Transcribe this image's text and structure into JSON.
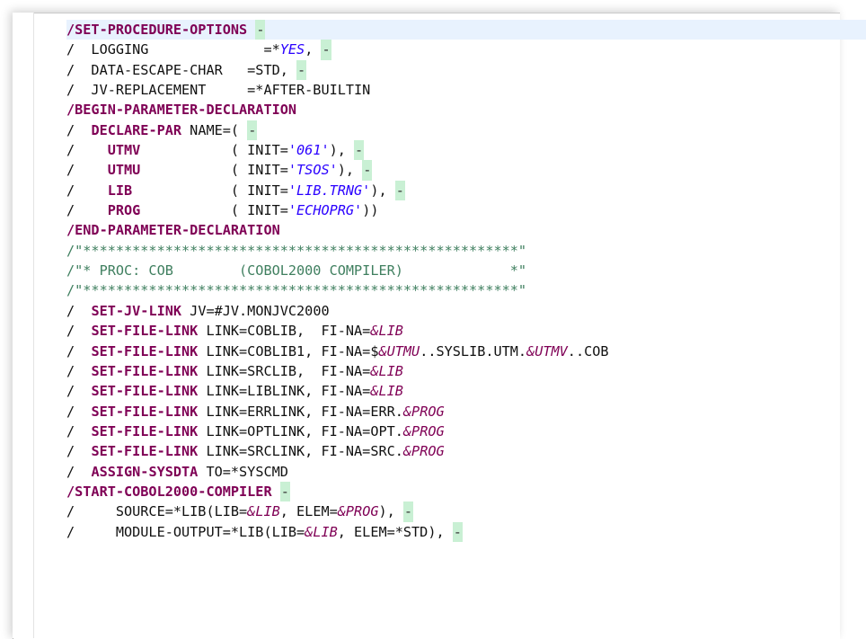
{
  "lines": [
    {
      "current": true,
      "segs": [
        [
          "kw",
          "/SET-PROCEDURE-OPTIONS"
        ],
        [
          "plain",
          " "
        ],
        [
          "cont",
          "-"
        ]
      ]
    },
    {
      "segs": [
        [
          "plain",
          "/  LOGGING              =*"
        ],
        [
          "str-up",
          "YES"
        ],
        [
          "plain",
          ", "
        ],
        [
          "cont",
          "-"
        ]
      ]
    },
    {
      "segs": [
        [
          "plain",
          "/  DATA-ESCAPE-CHAR   =STD, "
        ],
        [
          "cont",
          "-"
        ]
      ]
    },
    {
      "segs": [
        [
          "plain",
          "/  JV-REPLACEMENT     =*AFTER-BUILTIN"
        ]
      ]
    },
    {
      "segs": [
        [
          "kw",
          "/BEGIN-PARAMETER-DECLARATION"
        ]
      ]
    },
    {
      "segs": [
        [
          "plain",
          "/  "
        ],
        [
          "kw",
          "DECLARE-PAR"
        ],
        [
          "plain",
          " NAME=( "
        ],
        [
          "cont",
          "-"
        ]
      ]
    },
    {
      "segs": [
        [
          "plain",
          "/    "
        ],
        [
          "kw",
          "UTMV"
        ],
        [
          "plain",
          "           ( INIT="
        ],
        [
          "str",
          "'061'"
        ],
        [
          "plain",
          "), "
        ],
        [
          "cont",
          "-"
        ]
      ]
    },
    {
      "segs": [
        [
          "plain",
          "/    "
        ],
        [
          "kw",
          "UTMU"
        ],
        [
          "plain",
          "           ( INIT="
        ],
        [
          "str",
          "'TSOS'"
        ],
        [
          "plain",
          "), "
        ],
        [
          "cont",
          "-"
        ]
      ]
    },
    {
      "segs": [
        [
          "plain",
          "/    "
        ],
        [
          "kw",
          "LIB"
        ],
        [
          "plain",
          "            ( INIT="
        ],
        [
          "str",
          "'LIB.TRNG'"
        ],
        [
          "plain",
          "), "
        ],
        [
          "cont",
          "-"
        ]
      ]
    },
    {
      "segs": [
        [
          "plain",
          "/    "
        ],
        [
          "kw",
          "PROG"
        ],
        [
          "plain",
          "           ( INIT="
        ],
        [
          "str",
          "'ECHOPRG'"
        ],
        [
          "plain",
          "))"
        ]
      ]
    },
    {
      "segs": [
        [
          "kw",
          "/END-PARAMETER-DECLARATION"
        ]
      ]
    },
    {
      "segs": [
        [
          "cmt",
          "/\"*****************************************************\""
        ]
      ]
    },
    {
      "segs": [
        [
          "cmt",
          "/\"* PROC: COB        (COBOL2000 COMPILER)             *\""
        ]
      ]
    },
    {
      "segs": [
        [
          "cmt",
          "/\"*****************************************************\""
        ]
      ]
    },
    {
      "segs": [
        [
          "plain",
          "/  "
        ],
        [
          "kw",
          "SET-JV-LINK"
        ],
        [
          "plain",
          " JV=#JV.MONJVC2000"
        ]
      ]
    },
    {
      "segs": [
        [
          "plain",
          "/  "
        ],
        [
          "kw",
          "SET-FILE-LINK"
        ],
        [
          "plain",
          " LINK=COBLIB,  FI-NA="
        ],
        [
          "var",
          "&LIB"
        ]
      ]
    },
    {
      "segs": [
        [
          "plain",
          "/  "
        ],
        [
          "kw",
          "SET-FILE-LINK"
        ],
        [
          "plain",
          " LINK=COBLIB1, FI-NA=$"
        ],
        [
          "var",
          "&UTMU"
        ],
        [
          "plain",
          "..SYSLIB.UTM."
        ],
        [
          "var",
          "&UTMV"
        ],
        [
          "plain",
          "..COB"
        ]
      ]
    },
    {
      "segs": [
        [
          "plain",
          "/  "
        ],
        [
          "kw",
          "SET-FILE-LINK"
        ],
        [
          "plain",
          " LINK=SRCLIB,  FI-NA="
        ],
        [
          "var",
          "&LIB"
        ]
      ]
    },
    {
      "segs": [
        [
          "plain",
          "/  "
        ],
        [
          "kw",
          "SET-FILE-LINK"
        ],
        [
          "plain",
          " LINK=LIBLINK, FI-NA="
        ],
        [
          "var",
          "&LIB"
        ]
      ]
    },
    {
      "segs": [
        [
          "plain",
          "/  "
        ],
        [
          "kw",
          "SET-FILE-LINK"
        ],
        [
          "plain",
          " LINK=ERRLINK, FI-NA=ERR."
        ],
        [
          "var",
          "&PROG"
        ]
      ]
    },
    {
      "segs": [
        [
          "plain",
          "/  "
        ],
        [
          "kw",
          "SET-FILE-LINK"
        ],
        [
          "plain",
          " LINK=OPTLINK, FI-NA=OPT."
        ],
        [
          "var",
          "&PROG"
        ]
      ]
    },
    {
      "segs": [
        [
          "plain",
          "/  "
        ],
        [
          "kw",
          "SET-FILE-LINK"
        ],
        [
          "plain",
          " LINK=SRCLINK, FI-NA=SRC."
        ],
        [
          "var",
          "&PROG"
        ]
      ]
    },
    {
      "segs": [
        [
          "plain",
          "/  "
        ],
        [
          "kw",
          "ASSIGN-SYSDTA"
        ],
        [
          "plain",
          " TO=*SYSCMD"
        ]
      ]
    },
    {
      "segs": [
        [
          "kw",
          "/START-COBOL2000-COMPILER"
        ],
        [
          "plain",
          " "
        ],
        [
          "cont",
          "-"
        ]
      ]
    },
    {
      "segs": [
        [
          "plain",
          "/     SOURCE=*LIB(LIB="
        ],
        [
          "var",
          "&LIB"
        ],
        [
          "plain",
          ", ELEM="
        ],
        [
          "var",
          "&PROG"
        ],
        [
          "plain",
          "), "
        ],
        [
          "cont",
          "-"
        ]
      ]
    },
    {
      "segs": [
        [
          "plain",
          "/     MODULE-OUTPUT=*LIB(LIB="
        ],
        [
          "var",
          "&LIB"
        ],
        [
          "plain",
          ", ELEM=*STD), "
        ],
        [
          "cont",
          "-"
        ]
      ]
    }
  ],
  "colors": {
    "keyword": "#7f0055",
    "string": "#2a00ff",
    "comment": "#3f7f5f",
    "continuation_bg": "#c9f0d4",
    "current_line_bg": "#e8f2fe"
  }
}
